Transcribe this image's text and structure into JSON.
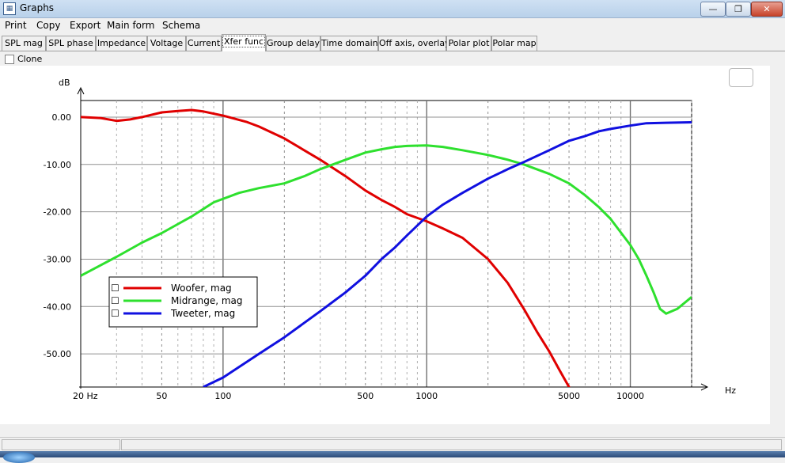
{
  "window": {
    "title": "Graphs",
    "app_icon": "graph-app-icon",
    "minimize_glyph": "—",
    "maximize_glyph": "❐",
    "close_glyph": "✕"
  },
  "menu": [
    {
      "label": "Print"
    },
    {
      "label": "Copy"
    },
    {
      "label": "Export"
    },
    {
      "label": "Main form"
    },
    {
      "label": "Schema"
    }
  ],
  "tabs": [
    {
      "label": "SPL mag"
    },
    {
      "label": "SPL phase"
    },
    {
      "label": "Impedance"
    },
    {
      "label": "Voltage"
    },
    {
      "label": "Current"
    },
    {
      "label": "Xfer func",
      "active": true
    },
    {
      "label": "Group delay"
    },
    {
      "label": "Time domain"
    },
    {
      "label": "Off axis, overlay"
    },
    {
      "label": "Polar plot"
    },
    {
      "label": "Polar map"
    }
  ],
  "clone": {
    "label": "Clone",
    "checked": false
  },
  "chart_data": {
    "type": "line",
    "ylabel": "dB",
    "xlabel": "Hz",
    "xscale": "log",
    "xlim": [
      20,
      20000
    ],
    "ylim": [
      -57,
      3.5
    ],
    "yticks": [
      0,
      -10,
      -20,
      -30,
      -40,
      -50
    ],
    "ytick_labels": [
      "0.00",
      "-10.00",
      "-20.00",
      "-30.00",
      "-40.00",
      "-50.00"
    ],
    "xtick_labels": [
      {
        "value": 20,
        "label": "20 Hz"
      },
      {
        "value": 50,
        "label": "50"
      },
      {
        "value": 100,
        "label": "100"
      },
      {
        "value": 500,
        "label": "500"
      },
      {
        "value": 1000,
        "label": "1000"
      },
      {
        "value": 5000,
        "label": "5000"
      },
      {
        "value": 10000,
        "label": "10000"
      }
    ],
    "grid": true,
    "legend_position": "lower-left",
    "series": [
      {
        "name": "Woofer, mag",
        "color": "#e00000",
        "x": [
          20,
          25,
          30,
          35,
          40,
          50,
          60,
          70,
          80,
          100,
          130,
          150,
          200,
          250,
          300,
          400,
          500,
          600,
          700,
          800,
          1000,
          1200,
          1500,
          2000,
          2500,
          3000,
          3500,
          4000,
          4500,
          5000,
          5300
        ],
        "y": [
          0,
          -0.2,
          -0.8,
          -0.5,
          0,
          1,
          1.3,
          1.5,
          1.2,
          0.3,
          -1,
          -2,
          -4.5,
          -7,
          -9,
          -12.5,
          -15.5,
          -17.5,
          -19,
          -20.5,
          -22,
          -23.5,
          -25.5,
          -30,
          -35,
          -40.5,
          -45.5,
          -49.5,
          -53.5,
          -57,
          -58.5
        ]
      },
      {
        "name": "Midrange, mag",
        "color": "#2ee02e",
        "x": [
          20,
          30,
          40,
          50,
          70,
          90,
          120,
          150,
          200,
          250,
          300,
          400,
          500,
          600,
          700,
          800,
          1000,
          1200,
          1500,
          2000,
          2500,
          3000,
          4000,
          5000,
          6000,
          7000,
          8000,
          10000,
          11000,
          12000,
          13000,
          14000,
          15000,
          17000,
          20000
        ],
        "y": [
          -33.5,
          -29.5,
          -26.5,
          -24.5,
          -21,
          -18,
          -16,
          -15,
          -14,
          -12.5,
          -11,
          -9,
          -7.5,
          -6.8,
          -6.3,
          -6.1,
          -6,
          -6.3,
          -7,
          -8,
          -9,
          -10,
          -12,
          -14,
          -16.5,
          -19,
          -21.5,
          -27,
          -30,
          -33.5,
          -37,
          -40.5,
          -41.5,
          -40.5,
          -38
        ]
      },
      {
        "name": "Tweeter, mag",
        "color": "#1010e0",
        "x": [
          80,
          100,
          150,
          200,
          300,
          400,
          500,
          600,
          700,
          800,
          1000,
          1200,
          1500,
          2000,
          2500,
          3000,
          4000,
          5000,
          6000,
          7000,
          8000,
          10000,
          12000,
          15000,
          20000
        ],
        "y": [
          -57,
          -55,
          -50,
          -46.5,
          -41,
          -37,
          -33.5,
          -30,
          -27.5,
          -25,
          -21,
          -18.5,
          -16,
          -13,
          -11,
          -9.5,
          -7,
          -5,
          -4,
          -3,
          -2.5,
          -1.8,
          -1.3,
          -1.2,
          -1.1
        ]
      }
    ]
  },
  "legend_marker_glyph": "☐"
}
